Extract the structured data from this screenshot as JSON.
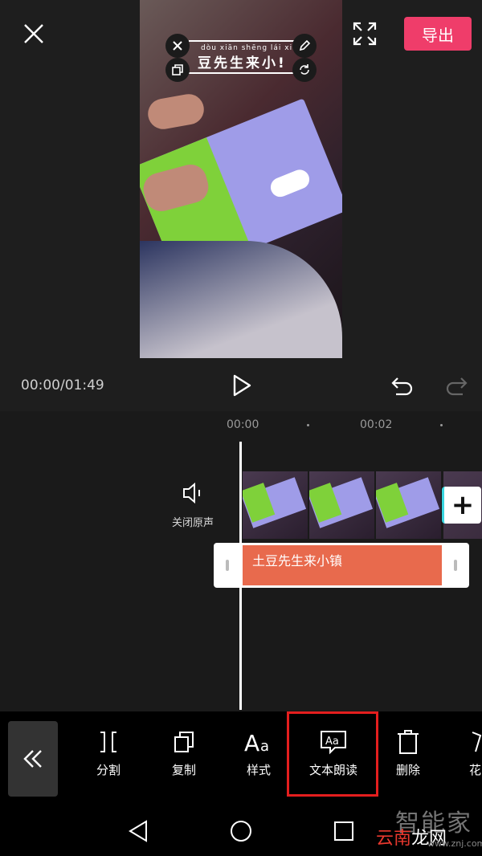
{
  "header": {
    "export_label": "导出"
  },
  "preview": {
    "caption_pinyin": "dòu  xiān  shēng  lái  xiǎo",
    "caption_text": "豆先生来小!"
  },
  "playback": {
    "time": "00:00/01:49"
  },
  "timeline": {
    "ticks": [
      "00:00",
      "00:02"
    ],
    "mute_label": "关闭原声",
    "text_clip_label": "土豆先生来小镇"
  },
  "toolbar": {
    "tools": [
      {
        "label": "分割",
        "icon": "split-icon"
      },
      {
        "label": "复制",
        "icon": "copy-icon"
      },
      {
        "label": "样式",
        "icon": "style-icon"
      },
      {
        "label": "文本朗读",
        "icon": "text-to-speech-icon"
      },
      {
        "label": "删除",
        "icon": "delete-icon"
      },
      {
        "label": "花",
        "icon": "flower-icon"
      }
    ],
    "highlight_color": "#e41e1e"
  },
  "watermark": {
    "line1": "智能家",
    "line2_red": "云南",
    "line2_white": "龙网",
    "url": "www.znj.com"
  },
  "colors": {
    "accent": "#ef3d6a",
    "text_clip": "#e86a4d",
    "background": "#1e1e1e"
  }
}
